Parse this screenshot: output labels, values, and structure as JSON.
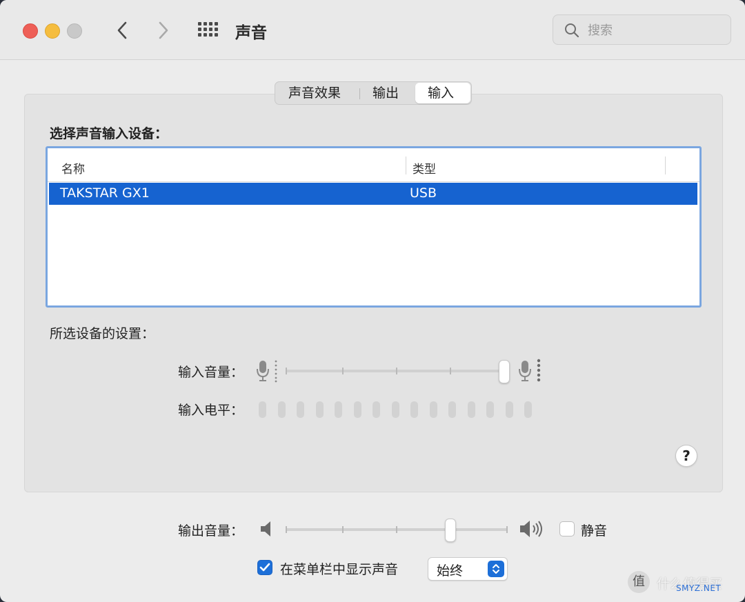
{
  "window": {
    "title": "声音"
  },
  "search": {
    "placeholder": "搜索"
  },
  "tabs": [
    {
      "label": "声音效果",
      "selected": false
    },
    {
      "label": "输出",
      "selected": false
    },
    {
      "label": "输入",
      "selected": true
    }
  ],
  "input": {
    "select_label": "选择声音输入设备：",
    "table": {
      "columns": [
        "名称",
        "类型"
      ],
      "rows": [
        {
          "name": "TAKSTAR GX1",
          "type": "USB",
          "selected": true
        }
      ]
    },
    "settings_label": "所选设备的设置：",
    "volume_label": "输入音量：",
    "volume_level": 0.98,
    "level_label": "输入电平：",
    "level_segments": 15,
    "level_active": 0
  },
  "output": {
    "volume_label": "输出音量：",
    "volume_level": 0.74,
    "mute_label": "静音",
    "mute_checked": false
  },
  "menubar": {
    "checkbox_label": "在菜单栏中显示声音",
    "checked": true,
    "popup_value": "始终"
  },
  "help": {
    "label": "?"
  },
  "watermark": {
    "text": "什么值得买",
    "sub": "SMYZ.NET"
  },
  "colors": {
    "accent": "#1663d0",
    "focus_ring": "#7aa6e0"
  }
}
